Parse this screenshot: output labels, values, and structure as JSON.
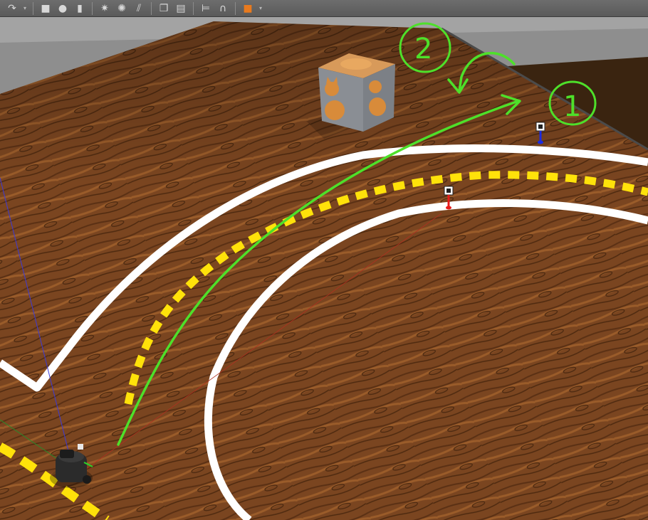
{
  "toolbar": {
    "tools": [
      {
        "name": "redo-icon",
        "glyph": "↷"
      },
      {
        "name": "history-dropdown-icon",
        "glyph": "▾"
      },
      {
        "name": "box-icon",
        "glyph": "■"
      },
      {
        "name": "sphere-icon",
        "glyph": "●"
      },
      {
        "name": "cylinder-icon",
        "glyph": "▮"
      },
      {
        "name": "point-light-icon",
        "glyph": "✷"
      },
      {
        "name": "spot-light-icon",
        "glyph": "✺"
      },
      {
        "name": "directional-light-icon",
        "glyph": "⫽"
      },
      {
        "name": "copy-icon",
        "glyph": "❐"
      },
      {
        "name": "paste-icon",
        "glyph": "▤"
      },
      {
        "name": "align-icon",
        "glyph": "⊨"
      },
      {
        "name": "snap-icon",
        "glyph": "∩"
      },
      {
        "name": "change-view-icon",
        "glyph": "■"
      }
    ],
    "accent": "#e87a1e"
  },
  "annotations": {
    "label_1": "1",
    "label_2": "2",
    "stroke_color": "#4ee02a"
  },
  "scene": {
    "floor_color": "#7a4a22",
    "wall_color": "#8e8e8e",
    "lane_line_color": "#ffffff",
    "center_dash_color": "#ffe20a"
  }
}
